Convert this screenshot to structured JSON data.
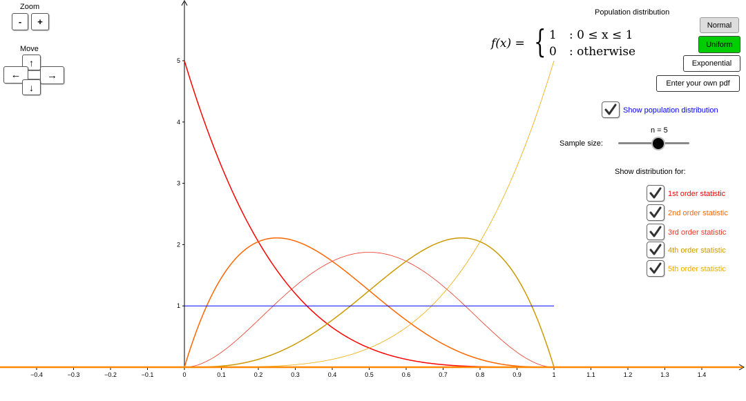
{
  "zoom": {
    "label": "Zoom",
    "minus": "-",
    "plus": "+"
  },
  "move": {
    "label": "Move",
    "up": "↑",
    "down": "↓",
    "left": "←",
    "right": "→"
  },
  "population": {
    "title": "Population distribution",
    "buttons": {
      "normal": "Normal",
      "uniform": "Uniform",
      "exponential": "Exponential",
      "custom": "Enter your own pdf"
    },
    "selected": "uniform",
    "selected_color": "#00cc00"
  },
  "formula": {
    "lhs": "f(x) =",
    "row1_val": "1",
    "row1_cond": ": 0 ≤ x ≤ 1",
    "row2_val": "0",
    "row2_cond": ": otherwise"
  },
  "show_population": {
    "label": "Show population distribution",
    "checked": true,
    "color": "#0000ff"
  },
  "sample_size": {
    "label": "Sample size:",
    "value_text": "n = 5",
    "value": 5
  },
  "show_for": {
    "title": "Show distribution for:",
    "items": [
      {
        "label": "1st order statistic",
        "checked": true,
        "color": "#ff0000"
      },
      {
        "label": "2nd order statistic",
        "checked": true,
        "color": "#ff6600"
      },
      {
        "label": "3rd order statistic",
        "checked": true,
        "color": "#ee3322"
      },
      {
        "label": "4th order statistic",
        "checked": true,
        "color": "#cc9900"
      },
      {
        "label": "5th order statistic",
        "checked": true,
        "color": "#eeaa00"
      }
    ]
  },
  "chart_data": {
    "type": "line",
    "x_ticks": [
      "-0.4",
      "-0.3",
      "-0.2",
      "-0.1",
      "0",
      "0.1",
      "0.2",
      "0.3",
      "0.4",
      "0.5",
      "0.6",
      "0.7",
      "0.8",
      "0.9",
      "1",
      "1.1",
      "1.2",
      "1.3",
      "1.4"
    ],
    "y_ticks": [
      "1",
      "2",
      "3",
      "4",
      "5"
    ],
    "xlim": [
      -0.5,
      1.51
    ],
    "ylim": [
      -0.01,
      5.95
    ],
    "grid": false,
    "population_line": {
      "x": [
        0,
        1
      ],
      "y": [
        1,
        1
      ],
      "color": "#0000ff"
    },
    "series": [
      {
        "k": 1,
        "n": 5,
        "color": "#ff0000"
      },
      {
        "k": 2,
        "n": 5,
        "color": "#ff6600"
      },
      {
        "k": 3,
        "n": 5,
        "color": "#ee3322"
      },
      {
        "k": 4,
        "n": 5,
        "color": "#cc9900"
      },
      {
        "k": 5,
        "n": 5,
        "color": "#eeaa00"
      }
    ],
    "baseline_color": "#ff8800"
  }
}
